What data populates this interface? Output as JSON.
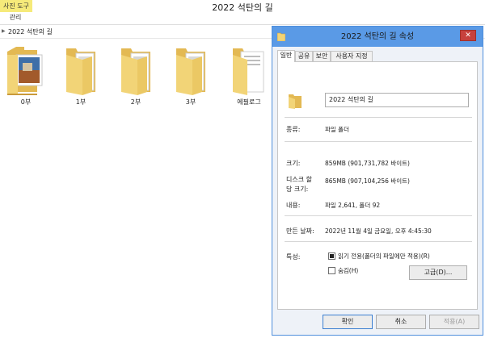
{
  "window": {
    "title": "2022 석탄의 길"
  },
  "ribbon": {
    "context_tab": "사진 도구",
    "tab": "관리"
  },
  "address": {
    "path": "2022 석탄의 길"
  },
  "folders": [
    {
      "label": "0부"
    },
    {
      "label": "1부"
    },
    {
      "label": "2부"
    },
    {
      "label": "3부"
    },
    {
      "label": "에필로그"
    }
  ],
  "dialog": {
    "title": "2022 석탄의 길 속성",
    "close_label": "✕",
    "tabs": [
      "일반",
      "공유",
      "보안",
      "사용자 지정"
    ],
    "name_value": "2022 석탄의 길",
    "type_label": "종류:",
    "type_value": "파일 폴더",
    "size_label": "크기:",
    "size_value": "859MB (901,731,782 바이트)",
    "disk_label_1": "디스크 할",
    "disk_label_2": "당 크기:",
    "disk_value": "865MB (907,104,256 바이트)",
    "contents_label": "내용:",
    "contents_value": "파일 2,641, 폴더 92",
    "created_label": "만든 날짜:",
    "created_value": "2022년 11월 4일 금요일, 오후 4:45:30",
    "attributes_label": "특성:",
    "readonly_label": "읽기 전용(폴더의 파일에만 적용)(R)",
    "readonly_checked": true,
    "hidden_label": "숨김(H)",
    "hidden_checked": false,
    "advanced_button": "고급(D)...",
    "ok_button": "확인",
    "cancel_button": "취소",
    "apply_button": "적용(A)"
  },
  "colors": {
    "titlebar": "#5a9ae6",
    "close": "#c7413d",
    "context_tab": "#f6ea7a",
    "folder": "#f2d477"
  }
}
